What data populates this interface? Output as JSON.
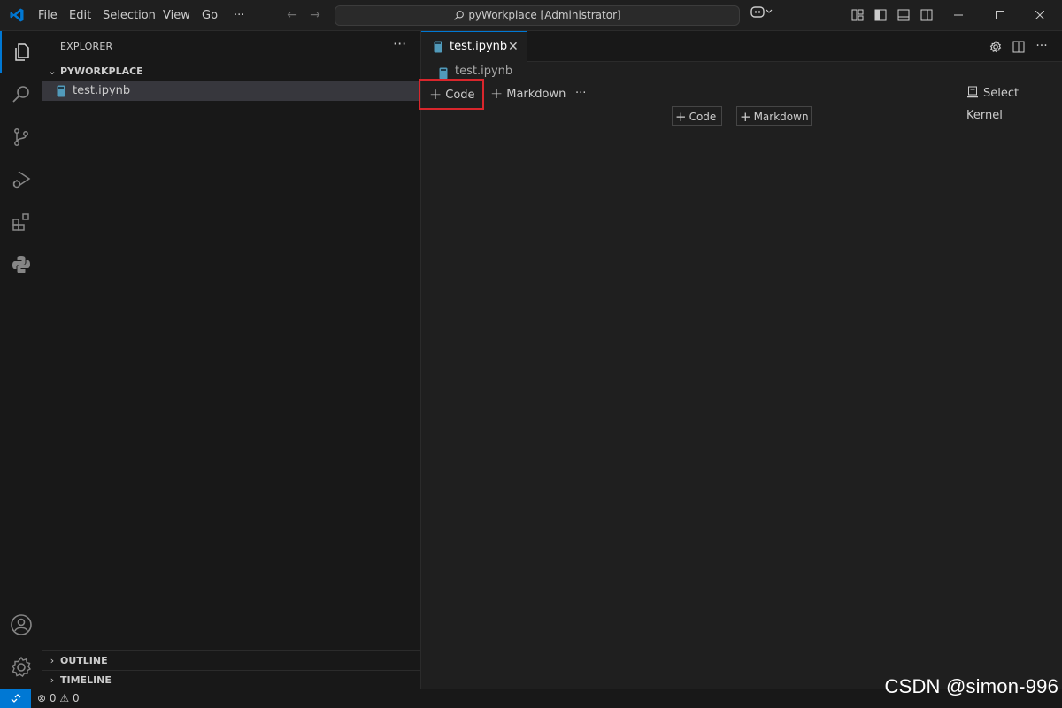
{
  "titlebar": {
    "menu": [
      "File",
      "Edit",
      "Selection",
      "View",
      "Go"
    ],
    "more": "···",
    "search_text": "pyWorkplace [Administrator]",
    "icons": [
      "back-arrow-icon",
      "forward-arrow-icon",
      "copilot-icon",
      "layout-icon",
      "toggle-sidebar-icon",
      "toggle-panel-icon",
      "toggle-secondary-sidebar-icon"
    ],
    "window_controls": [
      "minimize",
      "maximize",
      "close"
    ]
  },
  "activitybar": {
    "items": [
      "explorer-icon",
      "search-icon",
      "source-control-icon",
      "run-debug-icon",
      "extensions-icon",
      "python-icon"
    ],
    "bottom": [
      "account-icon",
      "manage-gear-icon"
    ]
  },
  "sidebar": {
    "title": "EXPLORER",
    "more": "···",
    "folder": "PYWORKPLACE",
    "files": [
      "test.ipynb"
    ],
    "outline": "OUTLINE",
    "timeline": "TIMELINE"
  },
  "editor": {
    "tab_label": "test.ipynb",
    "tab_close": "✕",
    "breadcrumb": "test.ipynb",
    "toolbar": {
      "code": "Code",
      "markdown": "Markdown",
      "more": "···",
      "select_kernel": "Select Kernel"
    },
    "cell_buttons": {
      "code": "Code",
      "markdown": "Markdown"
    }
  },
  "statusbar": {
    "errors": "0",
    "warnings": "0"
  },
  "watermark": "CSDN @simon-996",
  "colors": {
    "accent": "#0078d4",
    "highlight": "#d9262c",
    "notebook_icon": "#519aba"
  }
}
